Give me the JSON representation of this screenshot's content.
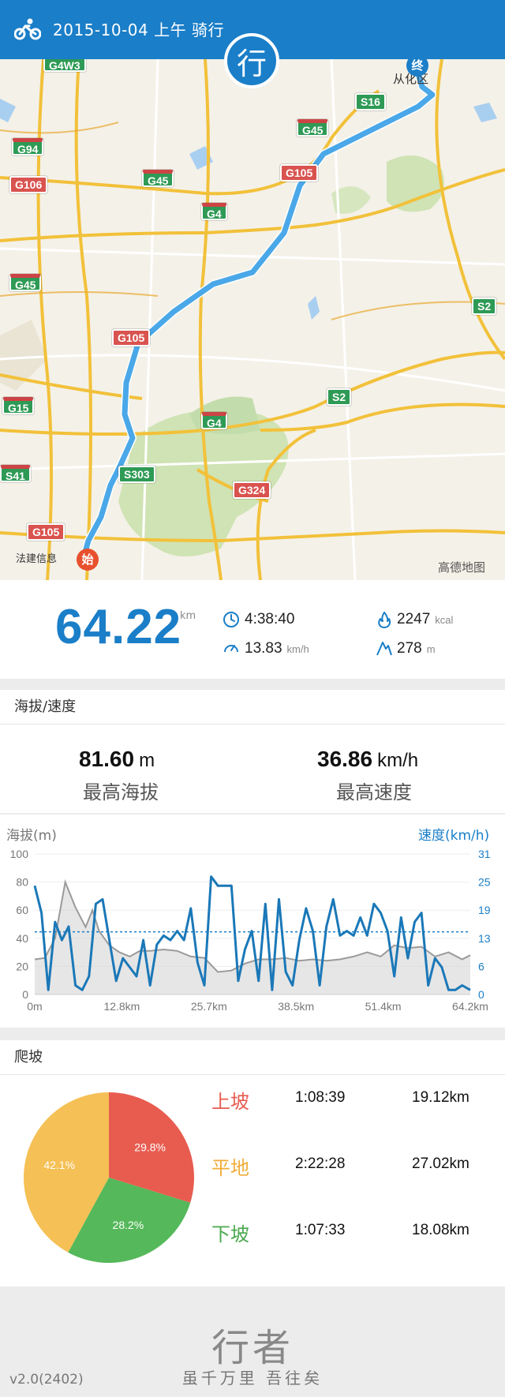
{
  "header": {
    "title": "2015-10-04 上午 骑行",
    "logo_char": "行"
  },
  "map": {
    "shields": [
      "G4W3",
      "G94",
      "G106",
      "G45",
      "G45",
      "G15",
      "S41",
      "G105",
      "G45",
      "G4",
      "G105",
      "G105",
      "G4",
      "S303",
      "G324",
      "S16",
      "S2",
      "S2"
    ],
    "places": {
      "end_town": "从化区",
      "start_town": "法建信息",
      "provider": "高德地图"
    },
    "start_pin": "始",
    "end_pin": "终",
    "route_color": "#4aa8e8"
  },
  "summary": {
    "distance": "64.22",
    "distance_unit": "km",
    "duration": "4:38:40",
    "avg_speed": "13.83",
    "avg_speed_unit": "km/h",
    "calories": "2247",
    "calories_unit": "kcal",
    "climb": "278",
    "climb_unit": "m"
  },
  "altitude_speed": {
    "section_title": "海拔/速度",
    "max_altitude": "81.60",
    "max_altitude_unit": "m",
    "max_altitude_label": "最高海拔",
    "max_speed": "36.86",
    "max_speed_unit": "km/h",
    "max_speed_label": "最高速度"
  },
  "chart_data": {
    "type": "line",
    "left_axis_label": "海拔(m)",
    "right_axis_label": "速度(km/h)",
    "left_ticks": [
      "100",
      "80",
      "60",
      "40",
      "20",
      "0"
    ],
    "right_ticks": [
      "31",
      "25",
      "19",
      "13",
      "6",
      "0"
    ],
    "x_ticks": [
      "0m",
      "12.8km",
      "25.7km",
      "38.5km",
      "51.4km",
      "64.2km"
    ],
    "ylim_left": [
      0,
      100
    ],
    "ylim_right": [
      0,
      31
    ],
    "xlim": [
      0,
      64.2
    ],
    "avg_speed_line": 13.83,
    "series": [
      {
        "name": "海拔(m)",
        "color": "#9a9a9a",
        "x": [
          0,
          1.5,
          3,
          4.5,
          6,
          7.5,
          8.5,
          9.5,
          11,
          12.5,
          14,
          15.5,
          17,
          19,
          21,
          23,
          25,
          27,
          29,
          31,
          33,
          35,
          37,
          39,
          41,
          43,
          45,
          47,
          49,
          51,
          53,
          55,
          57,
          59,
          61,
          63,
          64.2
        ],
        "values": [
          25,
          26,
          40,
          80,
          62,
          48,
          60,
          45,
          35,
          30,
          27,
          31,
          31,
          32,
          31,
          27,
          26,
          16,
          17,
          22,
          25,
          25,
          26,
          24,
          25,
          24,
          25,
          27,
          30,
          27,
          35,
          33,
          34,
          27,
          30,
          25,
          28
        ]
      },
      {
        "name": "速度(km/h)",
        "color": "#1a78b8",
        "x": [
          0,
          1,
          2,
          3,
          4,
          5,
          6,
          7,
          8,
          9,
          10,
          11,
          12,
          13,
          14,
          15,
          16,
          17,
          18,
          19,
          20,
          21,
          22,
          23,
          24,
          25,
          26,
          27,
          28,
          29,
          30,
          31,
          32,
          33,
          34,
          35,
          36,
          37,
          38,
          39,
          40,
          41,
          42,
          43,
          44,
          45,
          46,
          47,
          48,
          49,
          50,
          51,
          52,
          53,
          54,
          55,
          56,
          57,
          58,
          59,
          60,
          61,
          62,
          63,
          64.2
        ],
        "values": [
          24,
          18,
          1,
          16,
          12,
          15,
          2,
          1,
          4,
          20,
          21,
          12,
          3,
          8,
          6,
          4,
          12,
          2,
          11,
          13,
          12,
          14,
          12,
          19,
          7,
          2,
          26,
          24,
          24,
          24,
          3,
          10,
          14,
          3,
          20,
          1,
          21,
          5,
          2,
          12,
          19,
          14,
          2,
          15,
          21,
          13,
          14,
          13,
          17,
          13,
          20,
          18,
          14,
          4,
          17,
          8,
          16,
          18,
          2,
          8,
          6,
          1,
          1,
          2,
          1
        ]
      }
    ]
  },
  "climb": {
    "section_title": "爬坡",
    "rows": [
      {
        "label": "上坡",
        "time": "1:08:39",
        "distance": "19.12km",
        "percent": 29.8,
        "percent_text": "29.8%",
        "color": "#e85c50"
      },
      {
        "label": "平地",
        "time": "2:22:28",
        "distance": "27.02km",
        "percent": 42.1,
        "percent_text": "42.1%",
        "color": "#f5c055"
      },
      {
        "label": "下坡",
        "time": "1:07:33",
        "distance": "18.08km",
        "percent": 28.2,
        "percent_text": "28.2%",
        "color": "#55b85a"
      }
    ]
  },
  "footer": {
    "brand": "行者",
    "slogan": "虽千万里 吾往矣",
    "version": "v2.0(2402)"
  }
}
